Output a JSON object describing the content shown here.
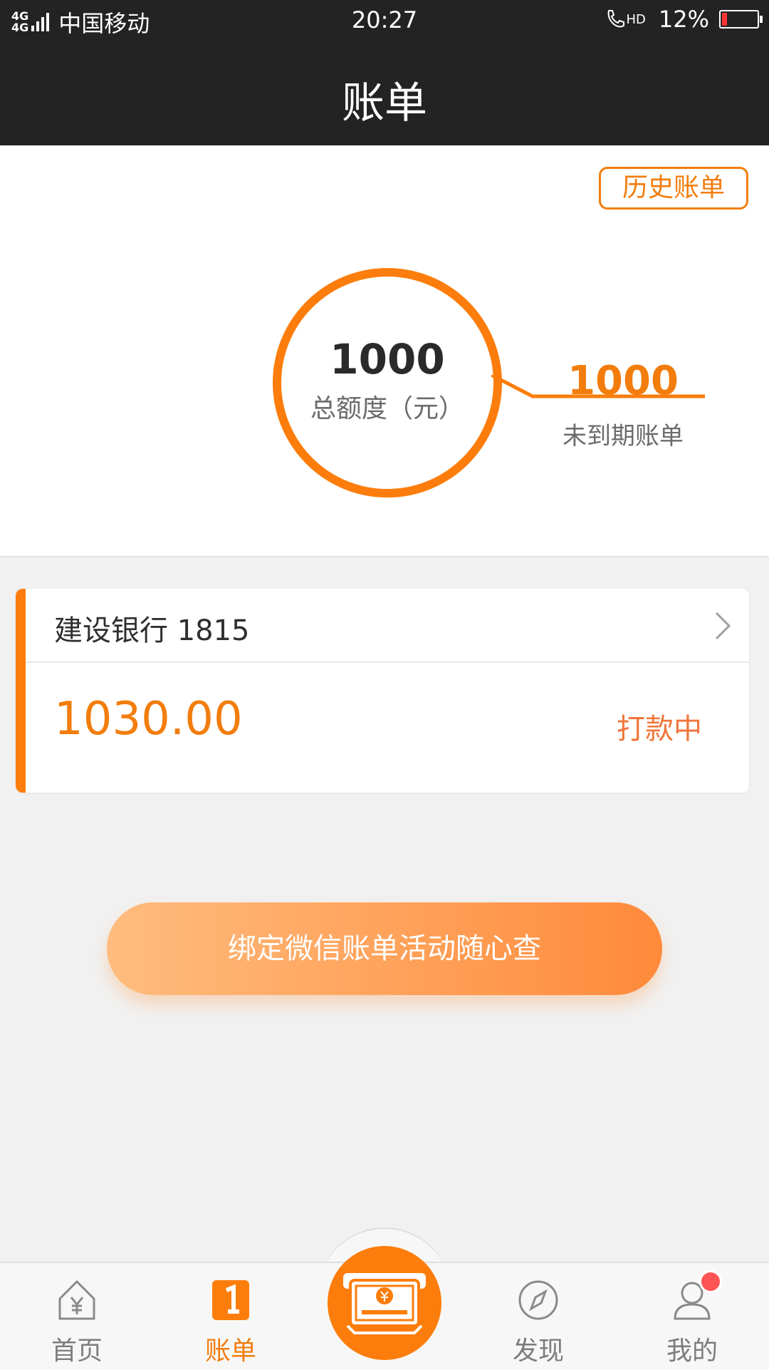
{
  "status_bar": {
    "network": "4G",
    "network2": "4G",
    "carrier": "中国移动",
    "time": "20:27",
    "hd": "HD",
    "battery": "12%",
    "battery_level": 0.12
  },
  "header": {
    "title": "账单"
  },
  "summary": {
    "history_button": "历史账单",
    "total_amount": "1000",
    "total_label": "总额度（元）",
    "unpaid_amount": "1000",
    "unpaid_label": "未到期账单"
  },
  "bill": {
    "bank": "建设银行 1815",
    "amount": "1030.00",
    "status": "打款中"
  },
  "bind_button": "绑定微信账单活动随心查",
  "tabs": [
    {
      "label": "首页",
      "icon": "home-yen-icon"
    },
    {
      "label": "账单",
      "icon": "bill-icon"
    },
    {
      "label": "",
      "icon": "cash-withdraw-icon"
    },
    {
      "label": "发现",
      "icon": "compass-icon"
    },
    {
      "label": "我的",
      "icon": "user-icon"
    }
  ],
  "colors": {
    "accent": "#fc7d0b",
    "dark": "#232323",
    "badge": "#ff5454"
  }
}
